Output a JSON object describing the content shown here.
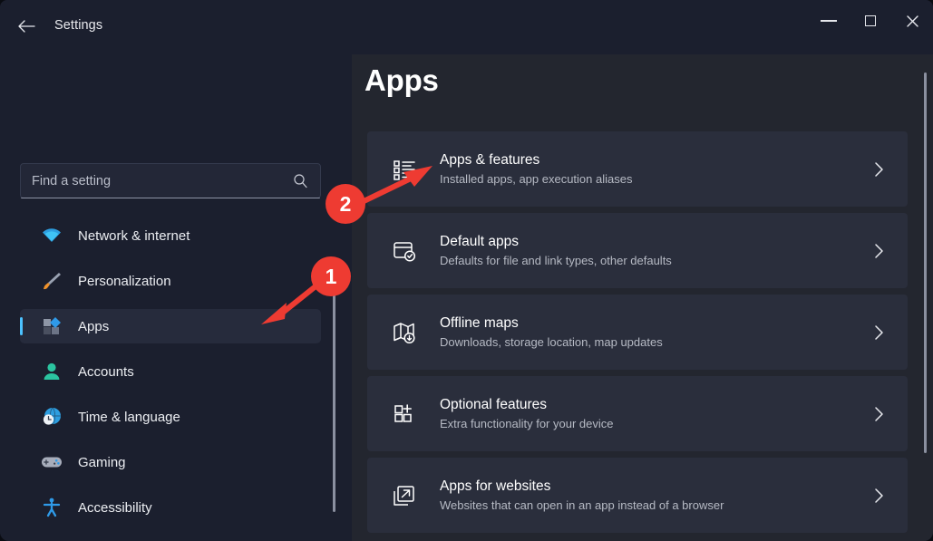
{
  "window": {
    "title": "Settings",
    "back_icon": "back-arrow-icon",
    "controls": {
      "minimize": "minimize-icon",
      "maximize": "maximize-icon",
      "close": "close-icon"
    }
  },
  "sidebar": {
    "search": {
      "placeholder": "Find a setting",
      "value": "",
      "icon": "search-icon"
    },
    "items": [
      {
        "label": "Network & internet",
        "icon": "wifi-icon",
        "active": false
      },
      {
        "label": "Personalization",
        "icon": "paintbrush-icon",
        "active": false
      },
      {
        "label": "Apps",
        "icon": "apps-grid-icon",
        "active": true
      },
      {
        "label": "Accounts",
        "icon": "person-icon",
        "active": false
      },
      {
        "label": "Time & language",
        "icon": "clock-globe-icon",
        "active": false
      },
      {
        "label": "Gaming",
        "icon": "gamepad-icon",
        "active": false
      },
      {
        "label": "Accessibility",
        "icon": "accessibility-person-icon",
        "active": false
      }
    ]
  },
  "main": {
    "page_title": "Apps",
    "cards": [
      {
        "title": "Apps & features",
        "subtitle": "Installed apps, app execution aliases",
        "icon": "bulleted-list-icon",
        "chevron": "chevron-right-icon"
      },
      {
        "title": "Default apps",
        "subtitle": "Defaults for file and link types, other defaults",
        "icon": "window-check-icon",
        "chevron": "chevron-right-icon"
      },
      {
        "title": "Offline maps",
        "subtitle": "Downloads, storage location, map updates",
        "icon": "map-download-icon",
        "chevron": "chevron-right-icon"
      },
      {
        "title": "Optional features",
        "subtitle": "Extra functionality for your device",
        "icon": "grid-plus-icon",
        "chevron": "chevron-right-icon"
      },
      {
        "title": "Apps for websites",
        "subtitle": "Websites that can open in an app instead of a browser",
        "icon": "external-link-icon",
        "chevron": "chevron-right-icon"
      }
    ]
  },
  "annotations": {
    "color": "#ee3b32",
    "steps": [
      {
        "number": "1",
        "points_to": "sidebar-item-apps"
      },
      {
        "number": "2",
        "points_to": "card-apps-and-features"
      }
    ]
  }
}
